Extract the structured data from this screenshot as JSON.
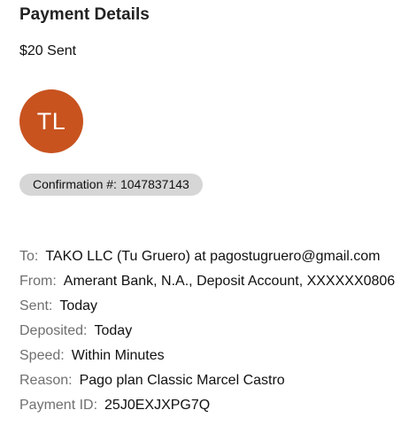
{
  "page_title": "Payment Details",
  "amount_text": "$20 Sent",
  "avatar": {
    "initials": "TL",
    "color": "#c8531f"
  },
  "confirmation": {
    "label": "Confirmation #:",
    "number": "1047837143"
  },
  "details": [
    {
      "label": "To:",
      "value": "TAKO LLC (Tu Gruero) at pagostugruero@gmail.com"
    },
    {
      "label": "From:",
      "value": "Amerant Bank, N.A., Deposit Account, XXXXXX0806"
    },
    {
      "label": "Sent:",
      "value": "Today"
    },
    {
      "label": "Deposited:",
      "value": "Today"
    },
    {
      "label": "Speed:",
      "value": "Within Minutes"
    },
    {
      "label": "Reason:",
      "value": "Pago plan Classic Marcel Castro"
    },
    {
      "label": "Payment ID:",
      "value": "25J0EXJXPG7Q"
    }
  ]
}
